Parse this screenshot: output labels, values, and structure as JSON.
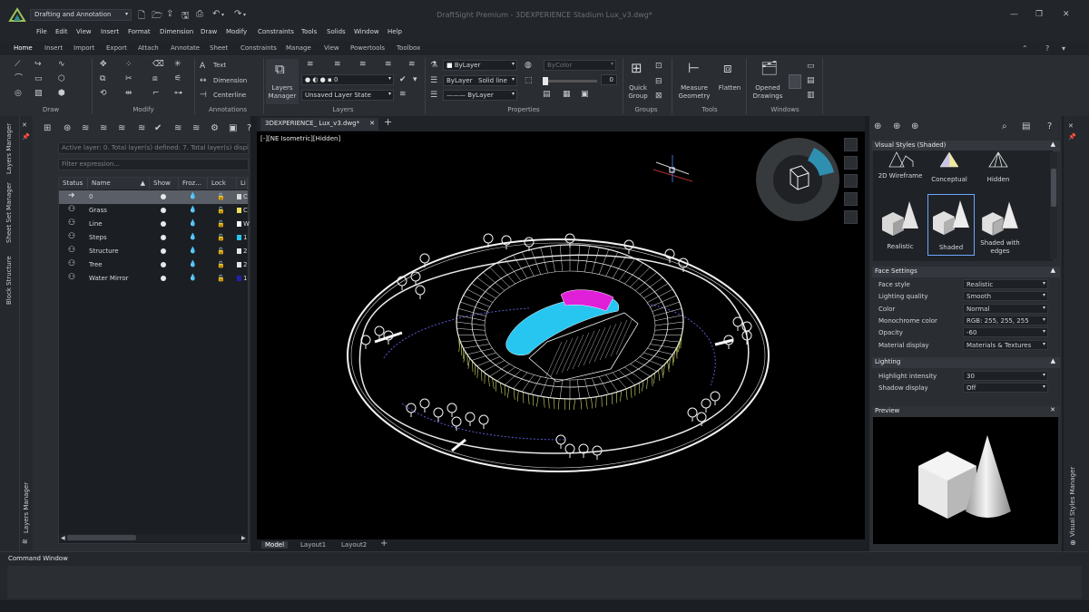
{
  "titlebar": {
    "workspace": "Drafting and Annotation",
    "title": "DraftSight Premium - 3DEXPERIENCE Stadium Lux_v3.dwg*"
  },
  "menubar": [
    "File",
    "Edit",
    "View",
    "Insert",
    "Format",
    "Dimension",
    "Draw",
    "Modify",
    "Constraints",
    "Tools",
    "Solids",
    "Window",
    "Help"
  ],
  "ribbon_tabs": [
    "Home",
    "Insert",
    "Import",
    "Export",
    "Attach",
    "Annotate",
    "Sheet",
    "Constraints",
    "Manage",
    "View",
    "Powertools",
    "Toolbox"
  ],
  "ribbon": {
    "groups": {
      "draw": "Draw",
      "modify": "Modify",
      "annotations": "Annotations",
      "layers": "Layers",
      "properties": "Properties",
      "groups": "Groups",
      "tools": "Tools",
      "windows": "Windows"
    },
    "annotations": {
      "text": "Text",
      "dimension": "Dimension",
      "centerline": "Centerline"
    },
    "layers": {
      "manager": "Layers Manager",
      "current_layer": "0",
      "layer_state": "Unsaved Layer State"
    },
    "properties": {
      "color": "ByLayer",
      "linetype_layer": "ByLayer",
      "linetype": "Solid line",
      "lineweight": "ByLayer",
      "bycolor": "ByColor",
      "transparency": "0"
    },
    "groups_btn": "Quick Group",
    "measure": "Measure Geometry",
    "flatten": "Flatten",
    "opened_drawings": "Opened Drawings"
  },
  "left_dock": [
    "Layers Manager",
    "Sheet Set Manager",
    "Block Structure"
  ],
  "left_dock_bottom": "Layers Manager",
  "layers_panel": {
    "active_info": "Active layer: 0. Total layer(s) defined: 7. Total layer(s) displayed: 7",
    "filter_placeholder": "Filter expression...",
    "columns": [
      "Status",
      "Name",
      "Show",
      "Froz...",
      "Lock",
      "Li"
    ],
    "rows": [
      {
        "name": "0",
        "color": "#d9d9d9",
        "linetype": "C",
        "selected": true
      },
      {
        "name": "Grass",
        "color": "#f0e060",
        "linetype": "C"
      },
      {
        "name": "Line",
        "color": "#ffffff",
        "linetype": "W"
      },
      {
        "name": "Steps",
        "color": "#26c6f0",
        "linetype": "1"
      },
      {
        "name": "Structure",
        "color": "#e6e6e6",
        "linetype": "2"
      },
      {
        "name": "Tree",
        "color": "#e6e6e6",
        "linetype": "2"
      },
      {
        "name": "Water Mirror",
        "color": "#2020b0",
        "linetype": "1"
      }
    ]
  },
  "document": {
    "tab": "3DEXPERIENCE_ Lux_v3.dwg*",
    "viewport_label": "[-][NE Isometric][Hidden]",
    "model_tabs": [
      "Model",
      "Layout1",
      "Layout2"
    ]
  },
  "right_panel": {
    "visual_styles_title": "Visual Styles (Shaded)",
    "styles": [
      {
        "label": "2D Wireframe"
      },
      {
        "label": "Conceptual"
      },
      {
        "label": "Hidden"
      },
      {
        "label": "Realistic"
      },
      {
        "label": "Shaded",
        "selected": true
      },
      {
        "label": "Shaded with edges"
      }
    ],
    "face_settings_title": "Face Settings",
    "face_settings": [
      {
        "label": "Face style",
        "value": "Realistic"
      },
      {
        "label": "Lighting quality",
        "value": "Smooth"
      },
      {
        "label": "Color",
        "value": "Normal"
      },
      {
        "label": "Monochrome color",
        "value": "RGB: 255, 255, 255"
      },
      {
        "label": "Opacity",
        "value": "-60"
      },
      {
        "label": "Material display",
        "value": "Materials & Textures"
      }
    ],
    "lighting_title": "Lighting",
    "lighting": [
      {
        "label": "Highlight intensity",
        "value": "30"
      },
      {
        "label": "Shadow display",
        "value": "Off"
      }
    ],
    "preview_title": "Preview"
  },
  "right_dock": "Visual Styles Manager",
  "command_window": {
    "title": "Command Window"
  },
  "colors": {
    "accent_selected": "#6fa6ff",
    "stadium_cyan": "#26c6f0",
    "stadium_magenta": "#e020d8"
  }
}
